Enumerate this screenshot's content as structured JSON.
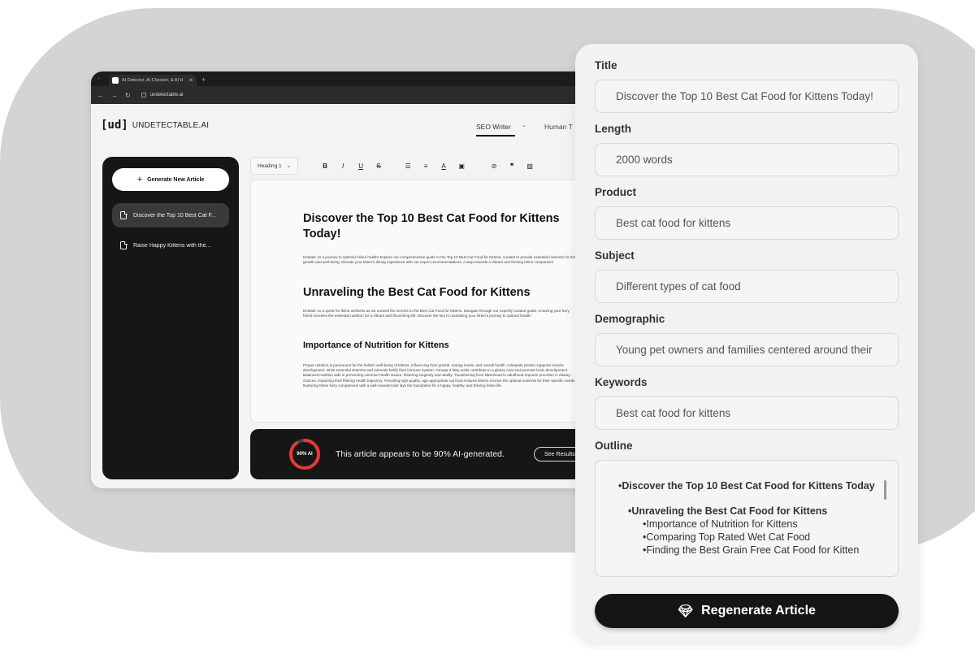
{
  "browser": {
    "tab_title": "AI Detector, AI Checker, & AI H",
    "url": "undetectable.ai",
    "nav": {
      "back": "←",
      "forward": "→",
      "reload": "↻"
    }
  },
  "app": {
    "logo_mark": "[ud]",
    "logo_word": "UNDETECTABLE.AI",
    "mode_active": "SEO Writer",
    "mode_other": "Human T"
  },
  "sidebar": {
    "generate_label": "Generate New Article",
    "items": [
      {
        "label": "Discover the Top 10 Best Cat F..."
      },
      {
        "label": "Raise Happy Kittens with the..."
      }
    ]
  },
  "toolbar": {
    "heading_select": "Heading 1",
    "icons": [
      "bold-icon",
      "italic-icon",
      "underline-icon",
      "strikethrough-icon",
      "bullet-list-icon",
      "numbered-list-icon",
      "text-color-icon",
      "highlight-icon",
      "link-icon",
      "quote-icon",
      "image-icon"
    ]
  },
  "article": {
    "title": "Discover the Top 10 Best Cat Food for Kittens Today!",
    "intro": "Embark on a journey to optimize feline health! Explore our comprehensive guide to the Top 10 Best Cat Food for Kittens, curated to provide essential nutrients for their growth and well-being. Elevate your kitten's dining experience with our expert recommendations, a step towards a vibrant and thriving feline companion!",
    "h2": "Unraveling the Best Cat Food for Kittens",
    "p2": "Embark on a quest for feline wellness as we unravel the secrets to the Best Cat Food for Kittens. Navigate through our expertly curated guide, ensuring your furry friend receives the essential nutrition for a vibrant and flourishing life. Discover the key to nourishing your kitten's journey to optimal health!",
    "h3": "Importance of Nutrition for Kittens",
    "p3": "Proper nutrition is paramount for the holistic well-being of kittens, influencing their growth, energy levels, and overall health. Adequate protein supports muscle development, while essential vitamins and minerals fortify their immune system. Omega-3 fatty acids contribute to a glossy coat and promote brain development. Balanced nutrition aids in preventing common health issues, fostering longevity and vitality. Transitioning from kittenhood to adulthood requires precision in dietary choices, impacting their lifelong health trajectory. Providing high-quality, age-appropriate cat food ensures kittens receive the optimal nutrients for their specific needs. Nurturing these furry companions with a well-rounded diet lays the foundation for a happy, healthy, and thriving feline life."
  },
  "detector": {
    "percent_label": "90% AI",
    "ai_fraction": 0.9,
    "message": "This article appears to be 90% AI-generated.",
    "see_results": "See Results",
    "ring_color": "#e53935"
  },
  "form": {
    "fields": [
      {
        "label": "Title",
        "value": "Discover the Top 10 Best Cat Food for Kittens Today!"
      },
      {
        "label": "Length",
        "value": "2000 words"
      },
      {
        "label": "Product",
        "value": "Best cat food for kittens"
      },
      {
        "label": "Subject",
        "value": "Different types of cat food"
      },
      {
        "label": "Demographic",
        "value": "Young pet owners and families centered around their"
      },
      {
        "label": "Keywords",
        "value": "Best cat food for kittens"
      }
    ],
    "outline_label": "Outline",
    "outline": [
      "•Discover the Top 10 Best Cat Food for Kittens Today",
      "•Unraveling the Best Cat Food for Kittens",
      "•Importance of Nutrition for Kittens",
      "•Comparing Top Rated Wet Cat Food",
      "•Finding the Best Grain Free Cat Food for Kitten"
    ],
    "regenerate_label": "Regenerate Article"
  }
}
